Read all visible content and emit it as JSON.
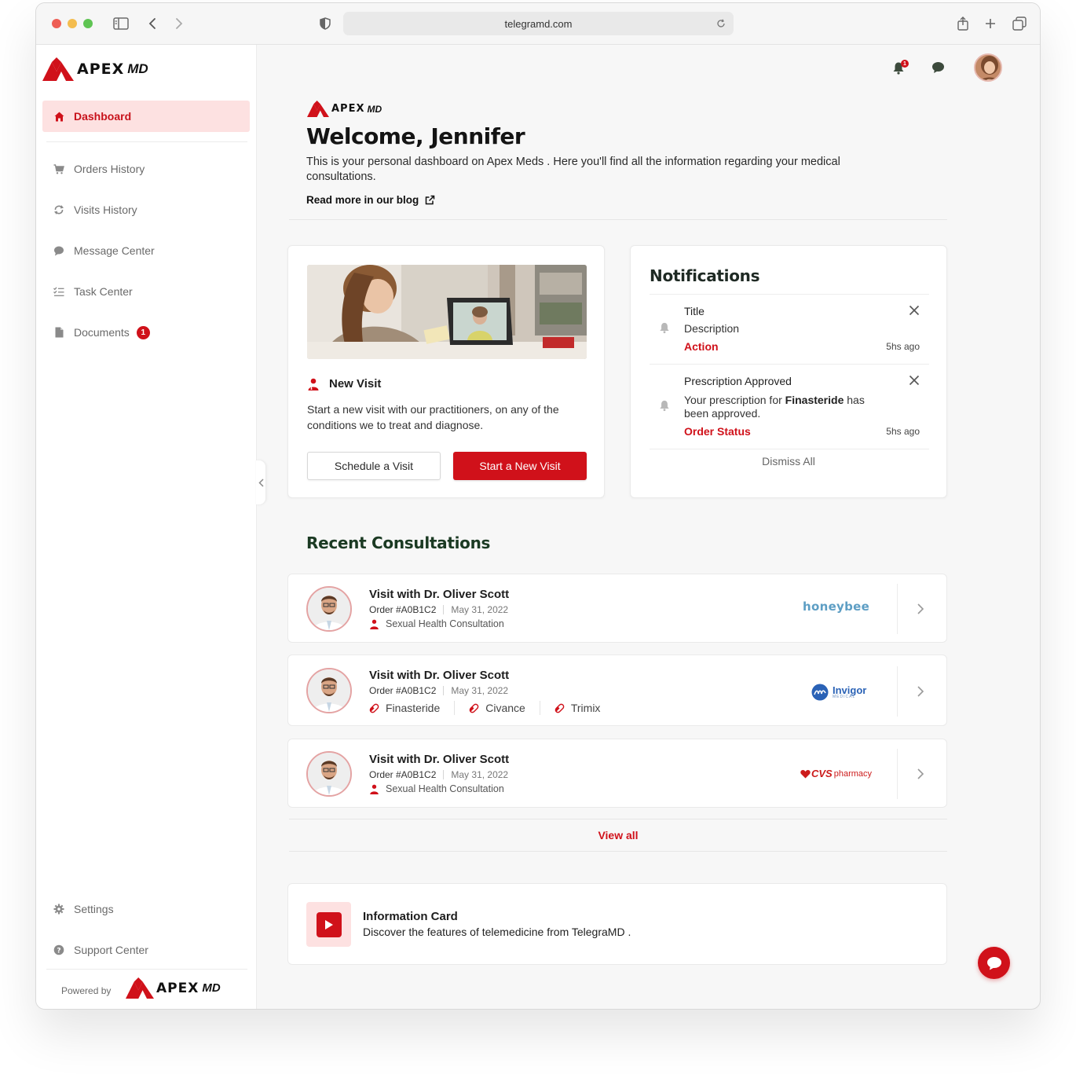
{
  "browser": {
    "url": "telegramd.com"
  },
  "brand": {
    "name": "APEX",
    "suffix": "MD"
  },
  "sidebar": {
    "active": {
      "label": "Dashboard",
      "icon": "home-icon"
    },
    "items": [
      {
        "label": "Orders History",
        "icon": "cart-icon"
      },
      {
        "label": "Visits History",
        "icon": "refresh-icon"
      },
      {
        "label": "Message Center",
        "icon": "chat-icon"
      },
      {
        "label": "Task Center",
        "icon": "checklist-icon"
      },
      {
        "label": "Documents",
        "icon": "document-icon",
        "badge": "1"
      }
    ],
    "bottom": [
      {
        "label": "Settings",
        "icon": "gear-icon"
      },
      {
        "label": "Support Center",
        "icon": "help-icon"
      }
    ],
    "powered_by": "Powered by"
  },
  "header": {
    "notification_count": "1"
  },
  "welcome": {
    "title": "Welcome, Jennifer",
    "intro": "This is your personal dashboard on Apex Meds . Here you'll find all the information regarding your medical consultations.",
    "blog_link": "Read more in our blog"
  },
  "new_visit": {
    "title": "New Visit",
    "description": "Start a new visit with our practitioners, on any of the conditions we to treat and diagnose.",
    "schedule_button": "Schedule a Visit",
    "start_button": "Start a New Visit"
  },
  "notifications": {
    "heading": "Notifications",
    "items": [
      {
        "title": "Title",
        "description": "Description",
        "action": "Action",
        "time": "5hs ago"
      },
      {
        "title": "Prescription Approved",
        "description_pre": "Your prescription for ",
        "description_bold": "Finasteride",
        "description_post": " has been approved.",
        "action": "Order Status",
        "time": "5hs ago"
      }
    ],
    "dismiss_all": "Dismiss All"
  },
  "recent": {
    "heading": "Recent Consultations",
    "items": [
      {
        "title": "Visit with Dr. Oliver Scott",
        "order": "Order #A0B1C2",
        "date": "May 31, 2022",
        "tag": "Sexual Health Consultation",
        "brand": "honeybee"
      },
      {
        "title": "Visit with Dr. Oliver Scott",
        "order": "Order #A0B1C2",
        "date": "May 31, 2022",
        "meds": [
          "Finasteride",
          "Civance",
          "Trimix"
        ],
        "brand": "Invigor",
        "brand_sub": "MEDICAL"
      },
      {
        "title": "Visit with Dr. Oliver Scott",
        "order": "Order #A0B1C2",
        "date": "May 31, 2022",
        "tag": "Sexual Health Consultation",
        "brand": "CVS",
        "brand_sub": "pharmacy"
      }
    ],
    "view_all": "View all"
  },
  "info_card": {
    "title": "Information Card",
    "description": "Discover the features of telemedicine from TelegraMD ."
  },
  "colors": {
    "accent": "#d0111a",
    "accent_light": "#fde1e1",
    "heading_green": "#1b3a23"
  }
}
